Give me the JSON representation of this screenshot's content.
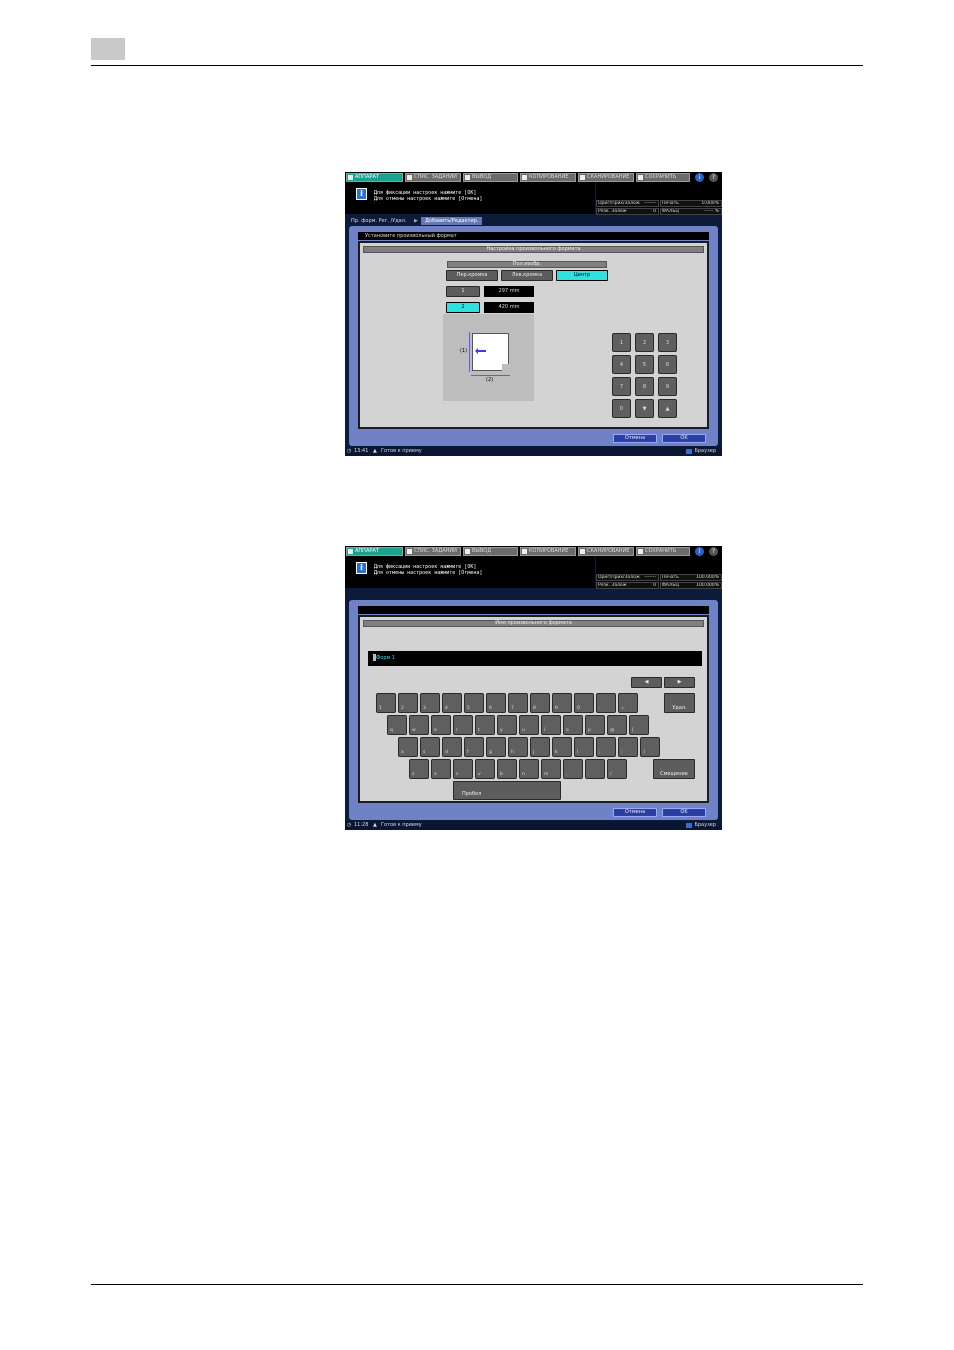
{
  "topbar": {
    "tabs": [
      "АППАРАТ",
      "СПИС. ЗАДАНИЙ",
      "ВЫВОД",
      "КОПИРОВАНИЕ",
      "СКАНИРОВАНИЕ",
      "СОХРАНИТЬ"
    ],
    "active": "АППАРАТ"
  },
  "messages": {
    "line1": "Для фиксации настроек нажмите [OK]",
    "line2": "Для отмены настроек нажмите [Отмена]"
  },
  "status": {
    "orig_label": "Ориг/Прих/Залож",
    "orig_val": "-------",
    "print_label": "Печать",
    "res_label": "Резк. Залож",
    "res_val": "0",
    "fold_label": "ФАЛЬЦ"
  },
  "screen1": {
    "status_print_val": "0.000%",
    "status_fold_val": "------ %",
    "breadcrumb_1": "Пр. форм. Рег. /Удал.",
    "breadcrumb_2": "Добавить/Редактир.",
    "instruction": "Установите произвольный формат",
    "section_title": "Настройка произвольного формата",
    "position_title": "Пол.изобр.",
    "pos_buttons": [
      "Пер.кромка",
      "Лев.кромка",
      "Центр"
    ],
    "pos_selected": "Центр",
    "dim1_label": "1",
    "dim1_value": "297 mm",
    "dim2_label": "2",
    "dim2_value": "420 mm",
    "diagram_label_1": "(1)",
    "diagram_label_2": "(2)",
    "keypad": [
      "1",
      "2",
      "3",
      "4",
      "5",
      "6",
      "7",
      "8",
      "9",
      "0",
      "▼",
      "▲"
    ],
    "cancel": "Отмена",
    "ok": "OK",
    "time": "13:41",
    "ready": "Готов к приему",
    "browse": "Браузер"
  },
  "screen2": {
    "status_print_val": "100.000%",
    "status_fold_val": "100.000%",
    "section_title": "Имя произвольного формата",
    "input_value": "Форм 1",
    "row1": [
      "1",
      "2",
      "3",
      "4",
      "5",
      "6",
      "7",
      "8",
      "9",
      "0",
      "-",
      "="
    ],
    "row2": [
      "q",
      "w",
      "e",
      "r",
      "t",
      "y",
      "u",
      "i",
      "o",
      "p",
      "@",
      "["
    ],
    "row3": [
      "a",
      "s",
      "d",
      "f",
      "g",
      "h",
      "j",
      "k",
      "l",
      ";",
      ":",
      "]"
    ],
    "row4": [
      "z",
      "x",
      "c",
      "v",
      "b",
      "n",
      "m",
      ",",
      ".",
      "/"
    ],
    "delete": "Удал.",
    "shift": "Смещение",
    "space": "Пробел",
    "cancel": "Отмена",
    "ok": "OK",
    "time": "11:28",
    "ready": "Готов к приему",
    "browse": "Браузер"
  }
}
